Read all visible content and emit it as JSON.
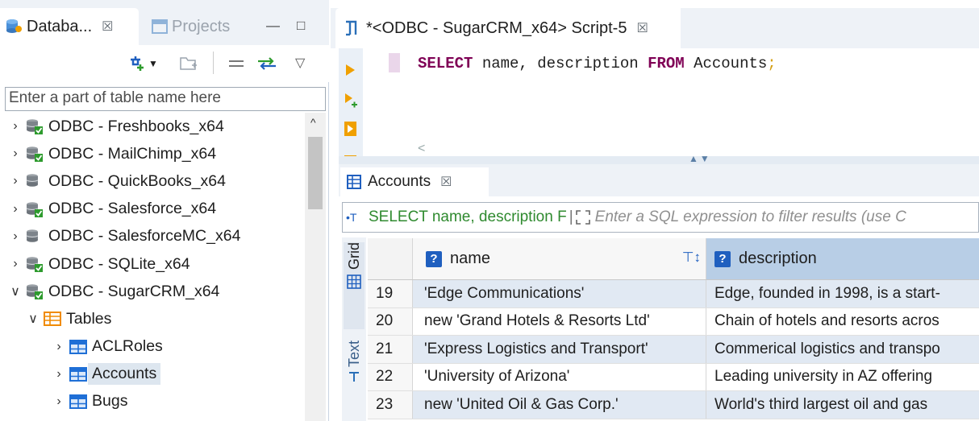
{
  "left_panel": {
    "tab_active": "Databa...",
    "tab_inactive": "Projects",
    "close_glyph": "☒",
    "minimize_glyph": "—",
    "maximize_glyph": "□",
    "filter_placeholder": "Enter a part of table name here",
    "tree": [
      {
        "label": "ODBC - Freshbooks_x64",
        "expanded": false,
        "connected": true
      },
      {
        "label": "ODBC - MailChimp_x64",
        "expanded": false,
        "connected": true
      },
      {
        "label": "ODBC - QuickBooks_x64",
        "expanded": false,
        "connected": false
      },
      {
        "label": "ODBC - Salesforce_x64",
        "expanded": false,
        "connected": true
      },
      {
        "label": "ODBC - SalesforceMC_x64",
        "expanded": false,
        "connected": false
      },
      {
        "label": "ODBC - SQLite_x64",
        "expanded": false,
        "connected": true
      },
      {
        "label": "ODBC - SugarCRM_x64",
        "expanded": true,
        "connected": true
      },
      {
        "label": "Tables",
        "expanded": true,
        "type": "folder"
      },
      {
        "label": "ACLRoles",
        "expanded": false,
        "type": "table"
      },
      {
        "label": "Accounts",
        "expanded": false,
        "type": "table",
        "selected": true
      },
      {
        "label": "Bugs",
        "expanded": false,
        "type": "table"
      }
    ]
  },
  "editor": {
    "tab_title": "*<ODBC - SugarCRM_x64> Script-5",
    "sql_select": "SELECT",
    "sql_mid": " name, description ",
    "sql_from": "FROM",
    "sql_table": " Accounts",
    "sql_semicolon": ";",
    "scroll_left_glyph": "<"
  },
  "results": {
    "tab_title": "Accounts",
    "filter_sql": "SELECT name, description F",
    "filter_placeholder": "Enter a SQL expression to filter results (use C",
    "vtab_grid": "Grid",
    "vtab_text": "Text",
    "columns": [
      "name",
      "description"
    ],
    "rows": [
      {
        "num": "19",
        "name": "'Edge Communications'",
        "description": "Edge, founded in 1998, is a start-"
      },
      {
        "num": "20",
        "name": "new 'Grand Hotels & Resorts Ltd'",
        "description": "Chain of hotels and resorts acros"
      },
      {
        "num": "21",
        "name": "'Express Logistics and Transport'",
        "description": "Commerical logistics and transpo"
      },
      {
        "num": "22",
        "name": "'University of Arizona'",
        "description": "Leading university in AZ offering"
      },
      {
        "num": "23",
        "name": "new 'United Oil & Gas Corp.'",
        "description": "World's third largest oil and gas"
      }
    ]
  },
  "colors": {
    "accent": "#1f5fbf",
    "keyword": "#7f0055",
    "sql_green": "#2f8a2f",
    "run_orange": "#f0a000"
  }
}
